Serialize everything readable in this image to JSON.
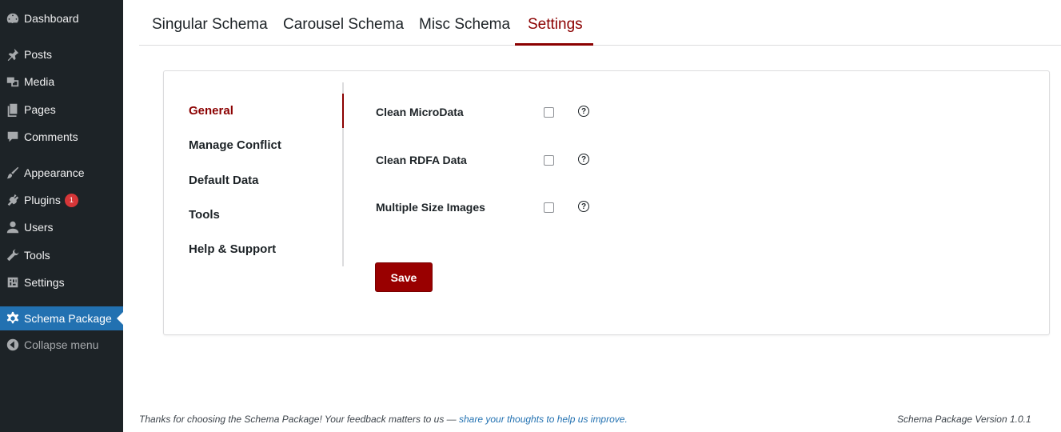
{
  "sidebar": {
    "items": [
      {
        "label": "Dashboard",
        "icon": "dashboard-icon"
      },
      {
        "label": "Posts",
        "icon": "pin-icon"
      },
      {
        "label": "Media",
        "icon": "media-icon"
      },
      {
        "label": "Pages",
        "icon": "pages-icon"
      },
      {
        "label": "Comments",
        "icon": "comment-icon"
      },
      {
        "label": "Appearance",
        "icon": "brush-icon"
      },
      {
        "label": "Plugins",
        "icon": "plugin-icon",
        "badge": "1"
      },
      {
        "label": "Users",
        "icon": "user-icon"
      },
      {
        "label": "Tools",
        "icon": "wrench-icon"
      },
      {
        "label": "Settings",
        "icon": "settings-icon"
      },
      {
        "label": "Schema Package",
        "icon": "gear-icon"
      },
      {
        "label": "Collapse menu",
        "icon": "collapse-icon"
      }
    ]
  },
  "tabs": {
    "items": [
      "Singular Schema",
      "Carousel Schema",
      "Misc Schema",
      "Settings"
    ],
    "active": "Settings"
  },
  "subnav": {
    "items": [
      "General",
      "Manage Conflict",
      "Default Data",
      "Tools",
      "Help & Support"
    ],
    "active": "General"
  },
  "options": [
    {
      "label": "Clean MicroData",
      "checked": false,
      "help": "?"
    },
    {
      "label": "Clean RDFA Data",
      "checked": false,
      "help": "?"
    },
    {
      "label": "Multiple Size Images",
      "checked": false,
      "help": "?"
    }
  ],
  "save_label": "Save",
  "footer": {
    "thanks_text": "Thanks for choosing the Schema Package! Your feedback matters to us — ",
    "link_text": "share your thoughts to help us improve.",
    "version_text": "Schema Package Version 1.0.1"
  },
  "colors": {
    "accent": "#8b0000",
    "sidebar_bg": "#1d2327",
    "active_menu": "#2271b1",
    "badge": "#d63638"
  }
}
